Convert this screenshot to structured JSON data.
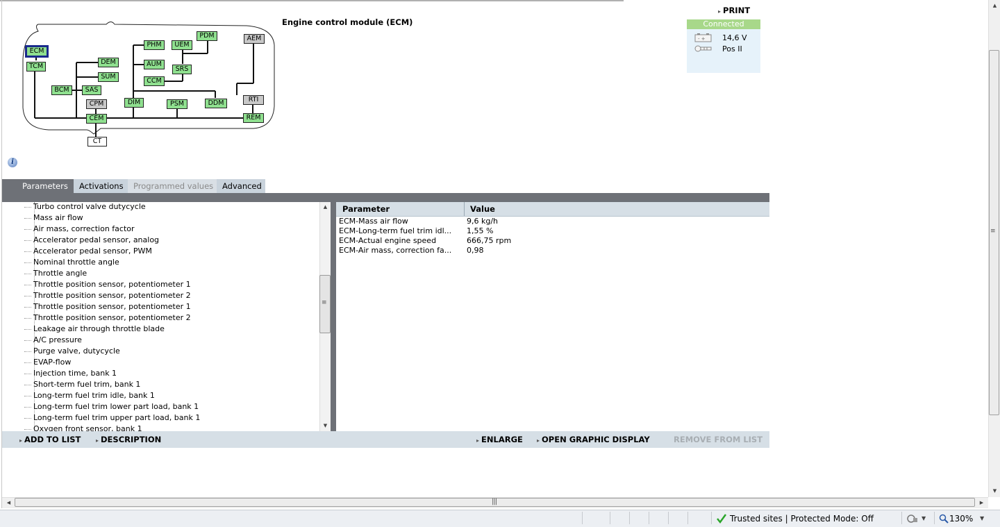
{
  "header": {
    "title": "Engine control module (ECM)",
    "print_label": "PRINT"
  },
  "status": {
    "connection": "Connected",
    "voltage": "14,6 V",
    "ignition": "Pos II",
    "connected_color": "#a8d88a"
  },
  "network": {
    "nodes": {
      "ecm": "ECM",
      "tcm": "TCM",
      "bcm": "BCM",
      "sas": "SAS",
      "dem": "DEM",
      "sum": "SUM",
      "cpm": "CPM",
      "cem": "CEM",
      "ct": "CT",
      "phm": "PHM",
      "aum": "AUM",
      "ccm": "CCM",
      "dim": "DIM",
      "uem": "UEM",
      "pdm": "PDM",
      "srs": "SRS",
      "psm": "PSM",
      "ddm": "DDM",
      "aem": "AEM",
      "rti": "RTI",
      "rem": "REM"
    }
  },
  "tabs": {
    "parameters": "Parameters",
    "activations": "Activations",
    "programmed": "Programmed values",
    "advanced": "Advanced"
  },
  "tree": {
    "items": [
      "Turbo control valve dutycycle",
      "Mass air flow",
      "Air mass, correction factor",
      "Accelerator pedal sensor, analog",
      "Accelerator pedal sensor, PWM",
      "Nominal throttle angle",
      "Throttle angle",
      "Throttle position sensor, potentiometer 1",
      "Throttle position sensor, potentiometer 2",
      "Throttle position sensor, potentiometer 1",
      "Throttle position sensor, potentiometer 2",
      "Leakage air through throttle blade",
      "A/C pressure",
      "Purge valve, dutycycle",
      "EVAP-flow",
      "Injection time, bank 1",
      "Short-term fuel trim, bank 1",
      "Long-term fuel trim idle, bank 1",
      "Long-term fuel trim lower part load, bank 1",
      "Long-term fuel trim upper part load, bank 1",
      "Oxygen front sensor, bank 1"
    ]
  },
  "table": {
    "headers": [
      "Parameter",
      "Value"
    ],
    "rows": [
      [
        "ECM-Mass air flow",
        "9,6 kg/h"
      ],
      [
        "ECM-Long-term fuel trim idl...",
        "1,55 %"
      ],
      [
        "ECM-Actual engine speed",
        "666,75 rpm"
      ],
      [
        "ECM-Air mass, correction fa...",
        "0,98"
      ]
    ]
  },
  "actions": {
    "add_to_list": "ADD TO LIST",
    "description": "DESCRIPTION",
    "enlarge": "ENLARGE",
    "open_graphic": "OPEN GRAPHIC DISPLAY",
    "remove": "REMOVE FROM LIST"
  },
  "statusbar": {
    "zone": "Trusted sites | Protected Mode: Off",
    "zoom": "130%"
  }
}
